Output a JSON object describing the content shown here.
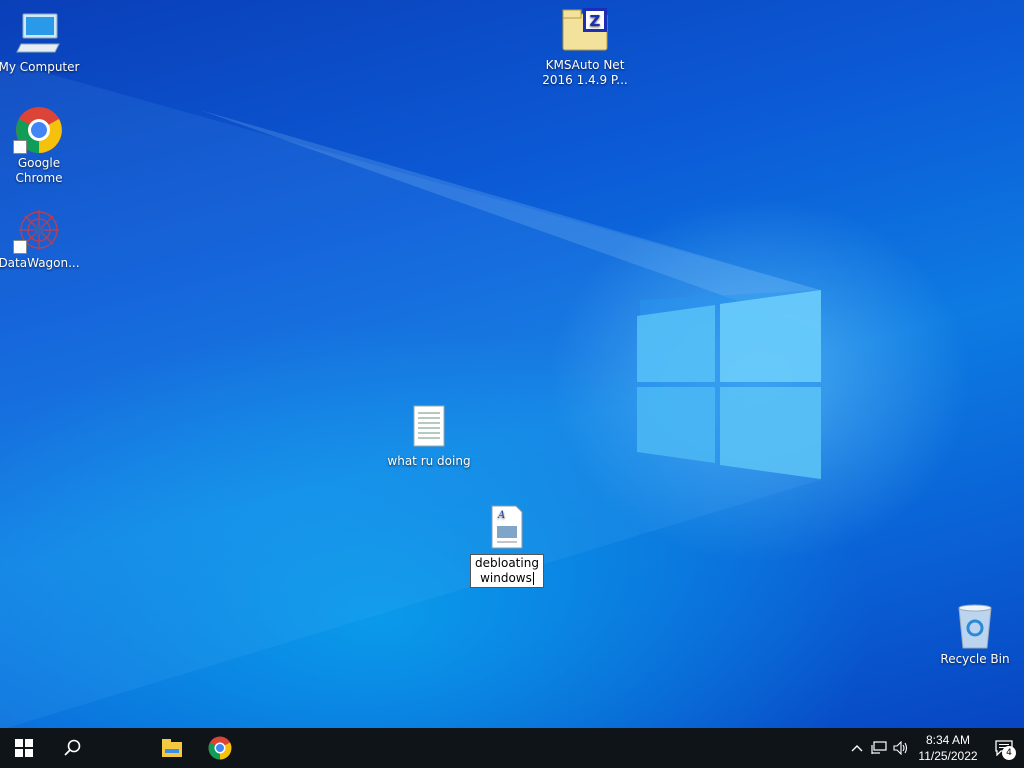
{
  "desktop": {
    "icons": [
      {
        "label": "My Computer"
      },
      {
        "label": "Google\nChrome"
      },
      {
        "label": "DataWagon..."
      },
      {
        "label": "KMSAuto Net\n2016 1.4.9 P..."
      },
      {
        "label": "what ru doing"
      },
      {
        "label": "debloating\nwindows"
      },
      {
        "label": "Recycle Bin"
      }
    ]
  },
  "taskbar": {
    "start_icon": "windows-logo-icon",
    "search_icon": "search-icon",
    "pinned": [
      "file-explorer-icon",
      "chrome-icon"
    ],
    "clock_time": "8:34 AM",
    "clock_date": "11/25/2022",
    "notification_count": "4"
  }
}
